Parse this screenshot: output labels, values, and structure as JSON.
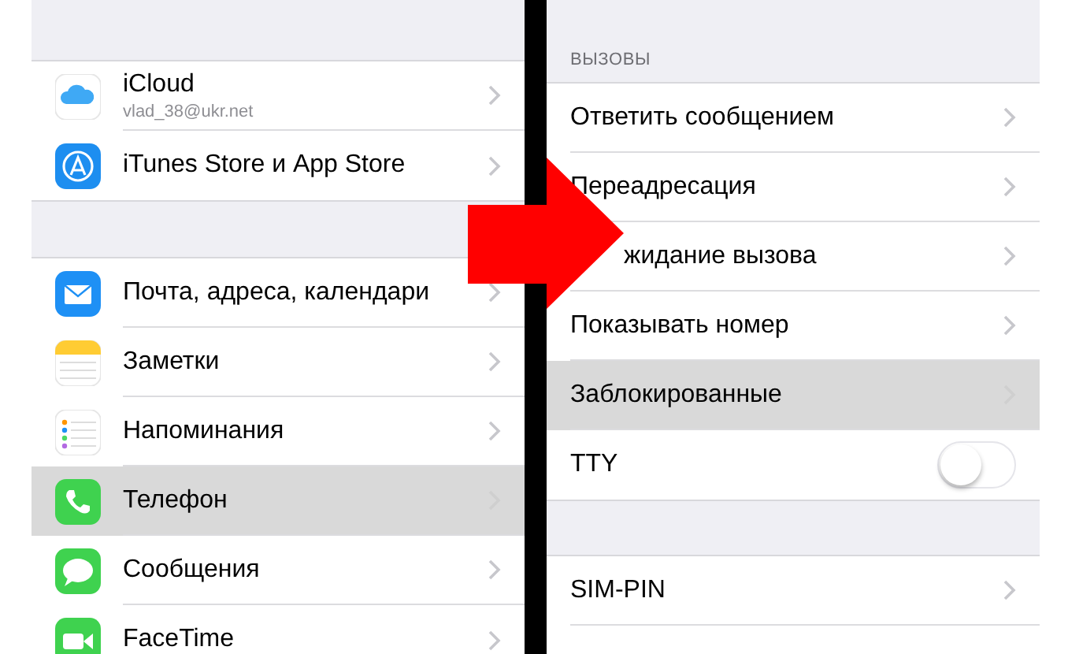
{
  "left_panel": {
    "groups": [
      {
        "items": [
          {
            "label": "iCloud",
            "detail": "vlad_38@ukr.net",
            "selected": false
          },
          {
            "label": "iTunes Store и App Store",
            "selected": false
          }
        ]
      },
      {
        "items": [
          {
            "label": "Почта, адреса, календари",
            "selected": false
          },
          {
            "label": "Заметки",
            "selected": false
          },
          {
            "label": "Напоминания",
            "selected": false
          },
          {
            "label": "Телефон",
            "selected": true
          },
          {
            "label": "Сообщения",
            "selected": false
          },
          {
            "label": "FaceTime",
            "selected": false
          }
        ]
      }
    ]
  },
  "right_panel": {
    "groups": [
      {
        "header": "ВЫЗОВЫ",
        "items": [
          {
            "kind": "link",
            "label": "Ответить сообщением",
            "selected": false
          },
          {
            "kind": "link",
            "label": "Переадресация",
            "selected": false
          },
          {
            "kind": "covered",
            "label": "жидание вызова",
            "selected": false
          },
          {
            "kind": "link",
            "label": "Показывать номер",
            "selected": false
          },
          {
            "kind": "link",
            "label": "Заблокированные",
            "selected": true
          },
          {
            "kind": "toggle",
            "label": "TTY",
            "on": false
          }
        ]
      },
      {
        "items": [
          {
            "kind": "link",
            "label": "SIM-PIN",
            "selected": false
          },
          {
            "kind": "blank"
          }
        ]
      }
    ]
  }
}
